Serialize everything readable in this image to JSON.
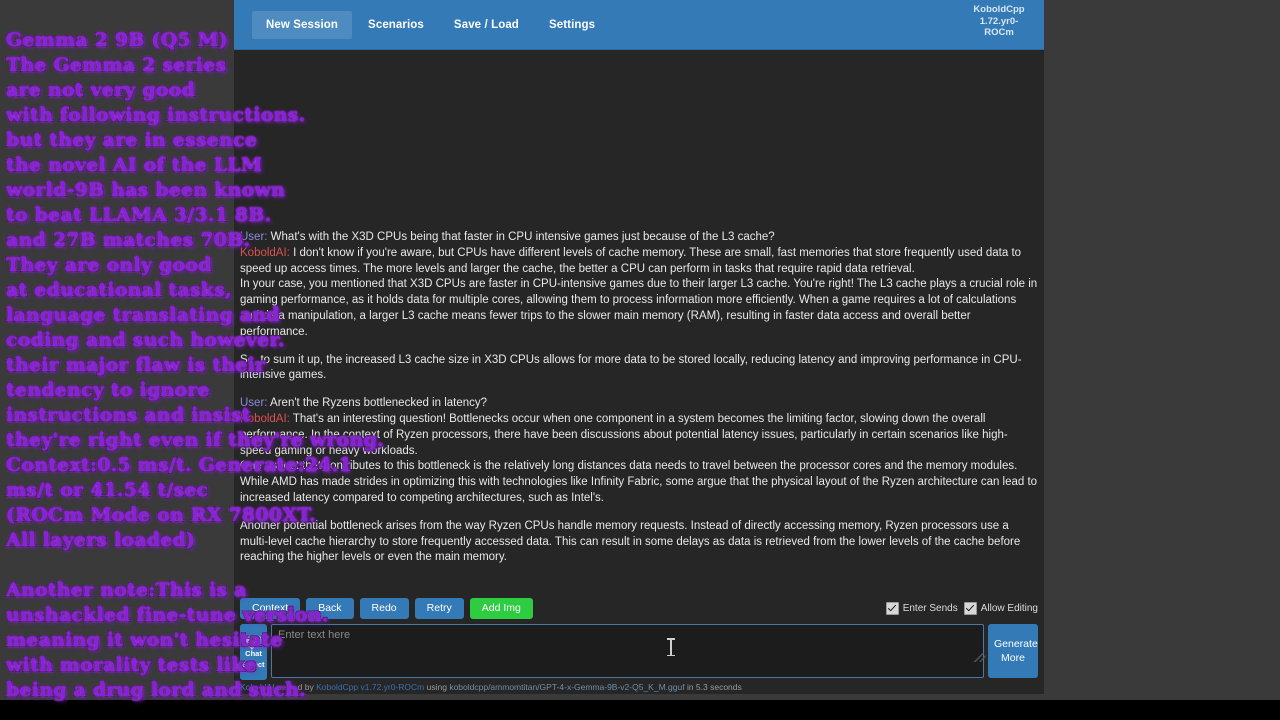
{
  "app": {
    "window_title": "KoboldCpp",
    "version_line1": "KoboldCpp",
    "version_line2": "1.72.yr0-",
    "version_line3": "ROCm",
    "accent_color": "#337ab7",
    "green_color": "#2ecc40",
    "overlay_color": "#8b1fe0",
    "background_color": "#262626"
  },
  "navbar": {
    "items": [
      {
        "label": "New Session",
        "name": "new-session"
      },
      {
        "label": "Scenarios",
        "name": "scenarios"
      },
      {
        "label": "Save / Load",
        "name": "save-load"
      },
      {
        "label": "Settings",
        "name": "settings"
      }
    ]
  },
  "chat": {
    "speaker_user": "User:",
    "speaker_ai": "KoboldAI:",
    "messages": [
      {
        "speaker": "User:",
        "speaker_type": "user",
        "text": " What's with the X3D CPUs being that faster in CPU intensive games just because of the L3 cache?"
      },
      {
        "speaker": "KoboldAI:",
        "speaker_type": "ai",
        "text": " I don't know if you're aware, but CPUs have different levels of cache memory. These are small, fast memories that store frequently used data to speed up access times. The more levels and larger the cache, the better a CPU can perform in tasks that require rapid data retrieval."
      },
      {
        "speaker": "",
        "speaker_type": "none",
        "text": "In your case, you mentioned that X3D CPUs are faster in CPU-intensive games due to their larger L3 cache. You're right! The L3 cache plays a crucial role in gaming performance, as it holds data for multiple cores, allowing them to process information more efficiently. When a game requires a lot of calculations and data manipulation, a larger L3 cache means fewer trips to the slower main memory (RAM), resulting in faster data access and overall better performance."
      },
      {
        "speaker": "",
        "speaker_type": "none",
        "text": "So, to sum it up, the increased L3 cache size in X3D CPUs allows for more data to be stored locally, reducing latency and improving performance in CPU-intensive games."
      },
      {
        "speaker": "User:",
        "speaker_type": "user",
        "text": " Aren't the Ryzens bottlenecked in latency?"
      },
      {
        "speaker": "KoboldAI:",
        "speaker_type": "ai",
        "text": " That's an interesting question! Bottlenecks occur when one component in a system becomes the limiting factor, slowing down the overall performance. In the context of Ryzen processors, there have been discussions about potential latency issues, particularly in certain scenarios like high-speed gaming or heavy workloads."
      },
      {
        "speaker": "",
        "speaker_type": "none",
        "text": "One aspect that contributes to this bottleneck is the relatively long distances data needs to travel between the processor cores and the memory modules. While AMD has made strides in optimizing this with technologies like Infinity Fabric, some argue that the physical layout of the Ryzen architecture can lead to increased latency compared to competing architectures, such as Intel's."
      },
      {
        "speaker": "",
        "speaker_type": "none",
        "text": "Another potential bottleneck arises from the way Ryzen CPUs handle memory requests. Instead of directly accessing memory, Ryzen processors use a multi-level cache hierarchy to store frequently accessed data. This can result in some delays as data is retrieved from the lower levels of the cache before reaching the higher levels or even the main memory."
      }
    ]
  },
  "actions": {
    "buttons": [
      {
        "label": "Context",
        "name": "context",
        "style": "blue"
      },
      {
        "label": "Back",
        "name": "back",
        "style": "blue"
      },
      {
        "label": "Redo",
        "name": "redo",
        "style": "blue"
      },
      {
        "label": "Retry",
        "name": "retry",
        "style": "blue"
      },
      {
        "label": "Add Img",
        "name": "add-img",
        "style": "green"
      }
    ],
    "checkboxes": [
      {
        "label": "Enter Sends",
        "name": "enter-sends",
        "checked": true
      },
      {
        "label": "Allow Editing",
        "name": "allow-editing",
        "checked": true
      }
    ]
  },
  "input": {
    "chat_select_line1": "Chat",
    "chat_select_line2": "Select",
    "placeholder": "Enter text here",
    "value": "",
    "generate_line1": "Generate",
    "generate_line2": "More"
  },
  "status": {
    "prefix": "KoboldAI",
    "served_by": " served by ",
    "engine": "KoboldCpp v1.72.yr0-ROCm",
    "using": " using ",
    "model": "koboldcpp/ammomtitan/GPT-4-x-Gemma-9B-v2-Q5_K_M.gguf",
    "suffix": " in 5.3 seconds"
  },
  "overlay_top": {
    "lines": [
      "Gemma 2 9B (Q5 M)",
      "The Gemma 2 series",
      "are not very good",
      "with following instructions.",
      "but they are in essence",
      "the novel AI of the LLM",
      "world-9B has been known",
      "to beat LLAMA 3/3.1 8B.",
      "and 27B matches 70B.",
      "They are only good",
      "at educational tasks,",
      "language translating and",
      "coding and such however.",
      "their major flaw is their",
      "tendency to ignore",
      "instructions and  insist",
      "they're right even if they're wrong.",
      "Context:0.5 ms/t.  Generate:24.1",
      "ms/t or 41.54 t/sec",
      "(ROCm Mode on RX 7800XT.",
      "All layers loaded)"
    ]
  },
  "overlay_bottom": {
    "lines": [
      "Another note:This is a",
      "unshackled fine-tune version.",
      "meaning it won't hesitate",
      "with morality tests like",
      "being a drug lord and such."
    ]
  }
}
